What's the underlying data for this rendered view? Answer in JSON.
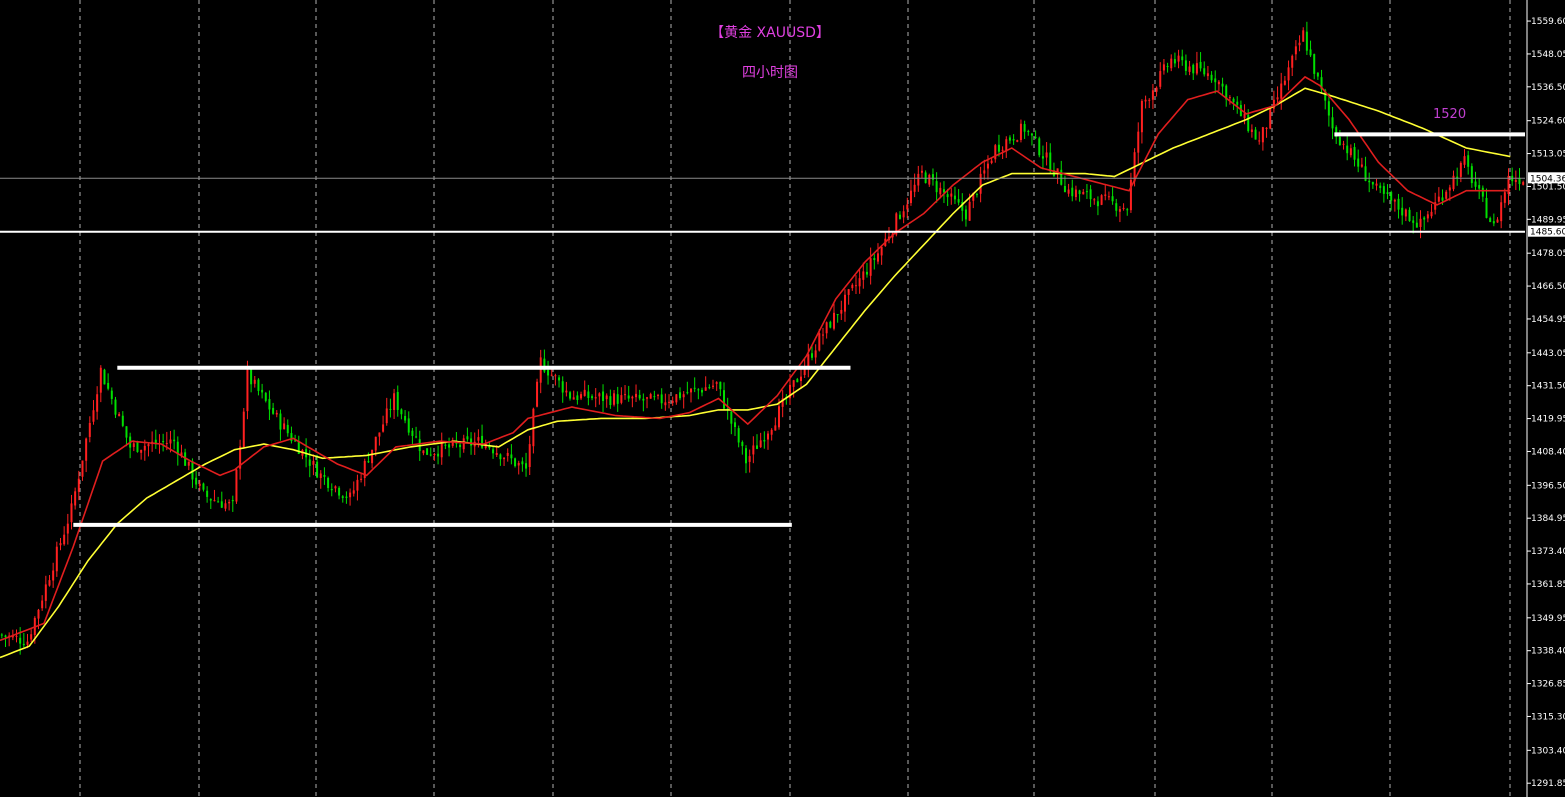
{
  "chart_data": {
    "type": "candlestick",
    "title": "【黄金 XAUUSD】",
    "subtitle": "四小时图",
    "colors": {
      "background": "#000000",
      "title": "#e040e0",
      "up_candle": "#ff2020",
      "down_candle": "#00e000",
      "ma_fast": "#e01e1e",
      "ma_slow": "#ffff33",
      "grid": "#cfcfcf",
      "axis": "#ffffff",
      "level": "#ffffff",
      "annotation": "#c040d0"
    },
    "grid": "vertical dashed",
    "ylim": [
      1287,
      1567
    ],
    "y_ticks": [
      "1559.60",
      "1548.05",
      "1536.50",
      "1524.60",
      "1513.05",
      "1501.50",
      "1489.95",
      "1478.05",
      "1466.50",
      "1454.95",
      "1443.05",
      "1431.50",
      "1419.95",
      "1408.40",
      "1396.50",
      "1384.95",
      "1373.40",
      "1361.85",
      "1349.95",
      "1338.40",
      "1326.85",
      "1315.30",
      "1303.40",
      "1291.85"
    ],
    "price_labels": [
      {
        "text": "1504.36",
        "value": 1504.36
      },
      {
        "text": "1485.60",
        "value": 1485.6
      }
    ],
    "annotations": [
      {
        "text": "1520",
        "value": 1520
      }
    ],
    "support_resistance": [
      {
        "value": 1437.8,
        "x_range": [
          8,
          58
        ]
      },
      {
        "value": 1382.6,
        "x_range": [
          5,
          54
        ]
      },
      {
        "value": 1485.6,
        "x_range": [
          0,
          104
        ]
      },
      {
        "value": 1519.8,
        "x_range": [
          91,
          104
        ]
      }
    ],
    "key_prices": [
      [
        0,
        1344
      ],
      [
        2,
        1342
      ],
      [
        5,
        1388
      ],
      [
        7,
        1437
      ],
      [
        9,
        1410
      ],
      [
        12,
        1412
      ],
      [
        14,
        1393
      ],
      [
        16,
        1389
      ],
      [
        17,
        1435
      ],
      [
        19,
        1420
      ],
      [
        22,
        1400
      ],
      [
        24,
        1392
      ],
      [
        27,
        1427
      ],
      [
        29,
        1408
      ],
      [
        33,
        1412
      ],
      [
        36,
        1402
      ],
      [
        37,
        1440
      ],
      [
        39,
        1428
      ],
      [
        45,
        1426
      ],
      [
        49,
        1432
      ],
      [
        51,
        1405
      ],
      [
        53,
        1420
      ],
      [
        56,
        1448
      ],
      [
        60,
        1478
      ],
      [
        63,
        1506
      ],
      [
        66,
        1492
      ],
      [
        68,
        1515
      ],
      [
        70,
        1522
      ],
      [
        73,
        1500
      ],
      [
        77,
        1494
      ],
      [
        78,
        1530
      ],
      [
        80,
        1546
      ],
      [
        83,
        1540
      ],
      [
        86,
        1517
      ],
      [
        89,
        1555
      ],
      [
        91,
        1522
      ],
      [
        94,
        1500
      ],
      [
        97,
        1488
      ],
      [
        100,
        1510
      ],
      [
        102,
        1487
      ],
      [
        103,
        1504.36
      ]
    ],
    "ma_fast_points": [
      [
        0,
        1342
      ],
      [
        3,
        1348
      ],
      [
        5,
        1375
      ],
      [
        7,
        1405
      ],
      [
        9,
        1412
      ],
      [
        11,
        1411
      ],
      [
        13,
        1405
      ],
      [
        15,
        1400
      ],
      [
        16,
        1402
      ],
      [
        18,
        1410
      ],
      [
        20,
        1413
      ],
      [
        23,
        1404
      ],
      [
        25,
        1400
      ],
      [
        27,
        1410
      ],
      [
        30,
        1412
      ],
      [
        33,
        1411
      ],
      [
        35,
        1415
      ],
      [
        36,
        1420
      ],
      [
        39,
        1424
      ],
      [
        42,
        1421
      ],
      [
        45,
        1420
      ],
      [
        47,
        1422
      ],
      [
        49,
        1427
      ],
      [
        51,
        1418
      ],
      [
        53,
        1428
      ],
      [
        55,
        1442
      ],
      [
        57,
        1462
      ],
      [
        59,
        1475
      ],
      [
        61,
        1485
      ],
      [
        63,
        1492
      ],
      [
        65,
        1502
      ],
      [
        67,
        1510
      ],
      [
        69,
        1515
      ],
      [
        71,
        1508
      ],
      [
        74,
        1504
      ],
      [
        77,
        1500
      ],
      [
        79,
        1520
      ],
      [
        81,
        1532
      ],
      [
        83,
        1535
      ],
      [
        85,
        1527
      ],
      [
        87,
        1530
      ],
      [
        89,
        1540
      ],
      [
        90,
        1537
      ],
      [
        92,
        1525
      ],
      [
        94,
        1510
      ],
      [
        96,
        1500
      ],
      [
        98,
        1495
      ],
      [
        100,
        1500
      ],
      [
        103,
        1500
      ]
    ],
    "ma_slow_points": [
      [
        0,
        1336
      ],
      [
        2,
        1340
      ],
      [
        4,
        1354
      ],
      [
        6,
        1370
      ],
      [
        8,
        1383
      ],
      [
        10,
        1392
      ],
      [
        12,
        1398
      ],
      [
        14,
        1404
      ],
      [
        16,
        1409
      ],
      [
        18,
        1411
      ],
      [
        20,
        1409
      ],
      [
        22,
        1406
      ],
      [
        25,
        1407
      ],
      [
        28,
        1410
      ],
      [
        31,
        1412
      ],
      [
        34,
        1410
      ],
      [
        36,
        1416
      ],
      [
        38,
        1419
      ],
      [
        41,
        1420
      ],
      [
        44,
        1420
      ],
      [
        47,
        1421
      ],
      [
        49,
        1423
      ],
      [
        51,
        1423
      ],
      [
        53,
        1425
      ],
      [
        55,
        1432
      ],
      [
        57,
        1445
      ],
      [
        59,
        1458
      ],
      [
        61,
        1470
      ],
      [
        63,
        1481
      ],
      [
        65,
        1492
      ],
      [
        67,
        1502
      ],
      [
        69,
        1506
      ],
      [
        71,
        1506
      ],
      [
        74,
        1506
      ],
      [
        76,
        1505
      ],
      [
        78,
        1510
      ],
      [
        80,
        1515
      ],
      [
        82,
        1519
      ],
      [
        85,
        1525
      ],
      [
        87,
        1530
      ],
      [
        89,
        1536
      ],
      [
        91,
        1533
      ],
      [
        94,
        1528
      ],
      [
        97,
        1522
      ],
      [
        100,
        1515
      ],
      [
        103,
        1512
      ]
    ]
  }
}
